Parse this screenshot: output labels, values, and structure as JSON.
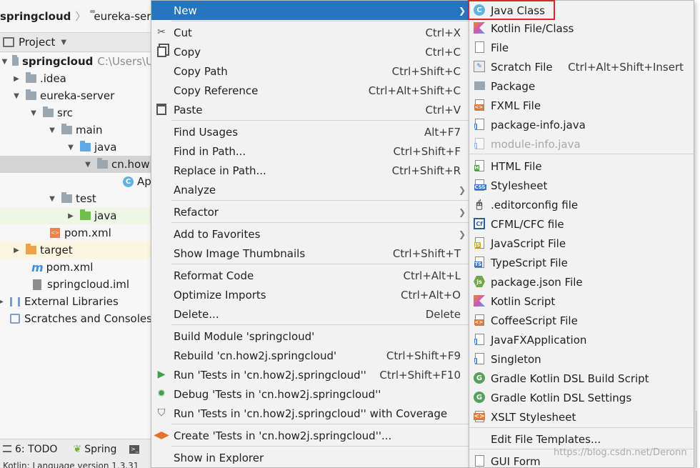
{
  "breadcrumb": {
    "root": "springcloud",
    "child": "eureka-server"
  },
  "project_panel": {
    "title": "Project"
  },
  "tree": [
    {
      "label": "springcloud",
      "hint": "C:\\Users\\U"
    },
    {
      "label": ".idea"
    },
    {
      "label": "eureka-server"
    },
    {
      "label": "src"
    },
    {
      "label": "main"
    },
    {
      "label": "java"
    },
    {
      "label": "cn.how"
    },
    {
      "label": "Ap"
    },
    {
      "label": "test"
    },
    {
      "label": "java"
    },
    {
      "label": "pom.xml"
    },
    {
      "label": "target"
    },
    {
      "label": "pom.xml"
    },
    {
      "label": "springcloud.iml"
    },
    {
      "label": "External Libraries"
    },
    {
      "label": "Scratches and Consoles"
    }
  ],
  "bottom_bar": {
    "todo": "6: TODO",
    "spring": "Spring",
    "status": "Kotlin: Language version 1.3.31"
  },
  "context_menu": {
    "items": [
      {
        "label": "New",
        "shortcut": ""
      },
      {
        "label": "Cut",
        "shortcut": "Ctrl+X"
      },
      {
        "label": "Copy",
        "shortcut": "Ctrl+C"
      },
      {
        "label": "Copy Path",
        "shortcut": "Ctrl+Shift+C"
      },
      {
        "label": "Copy Reference",
        "shortcut": "Ctrl+Alt+Shift+C"
      },
      {
        "label": "Paste",
        "shortcut": "Ctrl+V"
      },
      {
        "label": "Find Usages",
        "shortcut": "Alt+F7"
      },
      {
        "label": "Find in Path...",
        "shortcut": "Ctrl+Shift+F"
      },
      {
        "label": "Replace in Path...",
        "shortcut": "Ctrl+Shift+R"
      },
      {
        "label": "Analyze",
        "shortcut": ""
      },
      {
        "label": "Refactor",
        "shortcut": ""
      },
      {
        "label": "Add to Favorites",
        "shortcut": ""
      },
      {
        "label": "Show Image Thumbnails",
        "shortcut": "Ctrl+Shift+T"
      },
      {
        "label": "Reformat Code",
        "shortcut": "Ctrl+Alt+L"
      },
      {
        "label": "Optimize Imports",
        "shortcut": "Ctrl+Alt+O"
      },
      {
        "label": "Delete...",
        "shortcut": "Delete"
      },
      {
        "label": "Build Module 'springcloud'",
        "shortcut": ""
      },
      {
        "label": "Rebuild 'cn.how2j.springcloud'",
        "shortcut": "Ctrl+Shift+F9"
      },
      {
        "label": "Run 'Tests in 'cn.how2j.springcloud''",
        "shortcut": "Ctrl+Shift+F10"
      },
      {
        "label": "Debug 'Tests in 'cn.how2j.springcloud''",
        "shortcut": ""
      },
      {
        "label": "Run 'Tests in 'cn.how2j.springcloud'' with Coverage",
        "shortcut": ""
      },
      {
        "label": "Create 'Tests in 'cn.how2j.springcloud''...",
        "shortcut": ""
      },
      {
        "label": "Show in Explorer",
        "shortcut": ""
      }
    ]
  },
  "new_submenu": {
    "items": [
      {
        "label": "Java Class",
        "shortcut": ""
      },
      {
        "label": "Kotlin File/Class",
        "shortcut": ""
      },
      {
        "label": "File",
        "shortcut": ""
      },
      {
        "label": "Scratch File",
        "shortcut": "Ctrl+Alt+Shift+Insert"
      },
      {
        "label": "Package",
        "shortcut": ""
      },
      {
        "label": "FXML File",
        "shortcut": ""
      },
      {
        "label": "package-info.java",
        "shortcut": ""
      },
      {
        "label": "module-info.java",
        "shortcut": ""
      },
      {
        "label": "HTML File",
        "shortcut": ""
      },
      {
        "label": "Stylesheet",
        "shortcut": ""
      },
      {
        "label": ".editorconfig file",
        "shortcut": ""
      },
      {
        "label": "CFML/CFC file",
        "shortcut": ""
      },
      {
        "label": "JavaScript File",
        "shortcut": ""
      },
      {
        "label": "TypeScript File",
        "shortcut": ""
      },
      {
        "label": "package.json File",
        "shortcut": ""
      },
      {
        "label": "Kotlin Script",
        "shortcut": ""
      },
      {
        "label": "CoffeeScript File",
        "shortcut": ""
      },
      {
        "label": "JavaFXApplication",
        "shortcut": ""
      },
      {
        "label": "Singleton",
        "shortcut": ""
      },
      {
        "label": "Gradle Kotlin DSL Build Script",
        "shortcut": ""
      },
      {
        "label": "Gradle Kotlin DSL Settings",
        "shortcut": ""
      },
      {
        "label": "XSLT Stylesheet",
        "shortcut": ""
      },
      {
        "label": "Edit File Templates...",
        "shortcut": ""
      },
      {
        "label": "GUI Form",
        "shortcut": ""
      }
    ]
  },
  "watermark": "https://blog.csdn.net/Deronn",
  "colors": {
    "menu_highlight": "#2675bf",
    "annotation_box": "#e0242a"
  }
}
